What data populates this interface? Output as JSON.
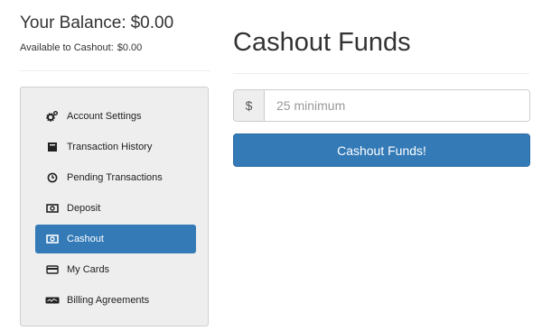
{
  "balance": {
    "label": "Your Balance:",
    "value": "$0.00",
    "available_label": "Available to Cashout:",
    "available_value": "$0.00"
  },
  "sidebar": {
    "items": [
      {
        "label": "Account Settings",
        "icon": "gears-icon",
        "active": false
      },
      {
        "label": "Transaction History",
        "icon": "book-icon",
        "active": false
      },
      {
        "label": "Pending Transactions",
        "icon": "clock-icon",
        "active": false
      },
      {
        "label": "Deposit",
        "icon": "money-icon",
        "active": false
      },
      {
        "label": "Cashout",
        "icon": "money-icon",
        "active": true
      },
      {
        "label": "My Cards",
        "icon": "credit-card-icon",
        "active": false
      },
      {
        "label": "Billing Agreements",
        "icon": "agreement-icon",
        "active": false
      }
    ]
  },
  "main": {
    "title": "Cashout Funds",
    "currency_addon": "$",
    "amount_placeholder": "25 minimum",
    "amount_value": "",
    "submit_label": "Cashout Funds!"
  },
  "colors": {
    "accent": "#337ab7",
    "sidebar_bg": "#eeeeee"
  }
}
